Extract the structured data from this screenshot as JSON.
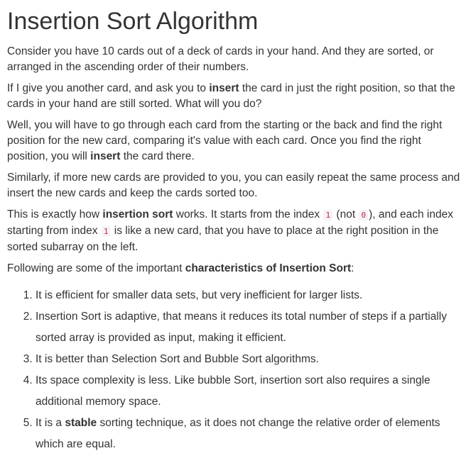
{
  "title": "Insertion Sort Algorithm",
  "p1": "Consider you have 10 cards out of a deck of cards in your hand. And they are sorted, or arranged in the ascending order of their numbers.",
  "p2": {
    "a": "If I give you another card, and ask you to ",
    "b": "insert",
    "c": " the card in just the right position, so that the cards in your hand are still sorted. What will you do?"
  },
  "p3": {
    "a": "Well, you will have to go through each card from the starting or the back and find the right position for the new card, comparing it's value with each card. Once you find the right position, you will ",
    "b": "insert",
    "c": " the card there."
  },
  "p4": "Similarly, if more new cards are provided to you, you can easily repeat the same process and insert the new cards and keep the cards sorted too.",
  "p5": {
    "a": "This is exactly how ",
    "b": "insertion sort",
    "c": " works. It starts from the index ",
    "code1": "1",
    "d": " (not ",
    "code2": "0",
    "e": "), and each index starting from index ",
    "code3": "1",
    "f": " is like a new card, that you have to place at the right position in the sorted subarray on the left."
  },
  "p6": {
    "a": "Following are some of the important ",
    "b": "characteristics of Insertion Sort",
    "c": ":"
  },
  "items": {
    "i1": "It is efficient for smaller data sets, but very inefficient for larger lists.",
    "i2": "Insertion Sort is adaptive, that means it reduces its total number of steps if a partially sorted array is provided as input, making it efficient.",
    "i3": "It is better than Selection Sort and Bubble Sort algorithms.",
    "i4": "Its space complexity is less. Like bubble Sort, insertion sort also requires a single additional memory space.",
    "i5": {
      "a": "It is a ",
      "b": "stable",
      "c": " sorting technique, as it does not change the relative order of elements which are equal."
    }
  }
}
